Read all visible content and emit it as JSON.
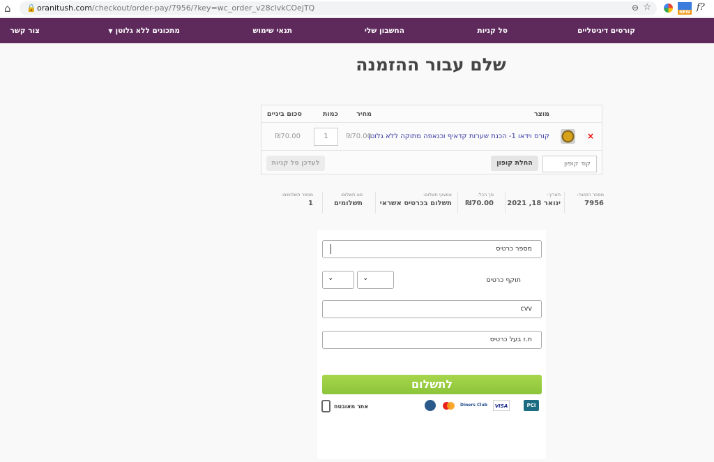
{
  "browser": {
    "url_host": "oranitush.com",
    "url_path": "/checkout/order-pay/7956/?key=wc_order_v28clvkCOejTQ",
    "ext_new_badge": "NEW",
    "ext_f_label": "f?"
  },
  "nav": {
    "items": [
      {
        "label": "קורסים דיגיטליים"
      },
      {
        "label": "סל קניות"
      },
      {
        "label": "החשבון שלי"
      },
      {
        "label": "תנאי שימוש"
      },
      {
        "label": "מתכונים ללא גלוטן"
      },
      {
        "label": "צור קשר"
      }
    ]
  },
  "page": {
    "title": "שלם עבור ההזמנה"
  },
  "order_table": {
    "headers": {
      "product": "מוצר",
      "price": "מחיר",
      "quantity": "כמות",
      "subtotal": "סכום ביניים"
    },
    "row": {
      "remove": "×",
      "name": "קורס וידאו 1- הכנת שערות קדאיף וכנאפה מתוקה ללא גלוטן",
      "price": "₪70.00",
      "quantity": "1",
      "subtotal": "₪70.00"
    },
    "coupon_placeholder": "קוד קופון",
    "apply_coupon": "החלת קופון",
    "update_cart": "לעדכן סל קניות"
  },
  "overview": [
    {
      "label": "מספר הזמנה:",
      "value": "7956"
    },
    {
      "label": "תאריך:",
      "value": "ינואר 18, 2021"
    },
    {
      "label": "סך הכל:",
      "value": "₪70.00"
    },
    {
      "label": "אמצעי תשלום:",
      "value": "תשלום בכרטיס אשראי"
    },
    {
      "label": "סוג תשלום:",
      "value": "תשלומים"
    },
    {
      "label": "מספר תשלומים:",
      "value": "1"
    }
  ],
  "payment": {
    "card_number_placeholder": "מספר כרטיס",
    "expiry_label": "תוקף כרטיס",
    "cvv_placeholder": "cvv",
    "id_placeholder": "ת.ז בעל כרטיס",
    "pay_button": "לתשלום",
    "secure_site": "אתר מאובטח",
    "brands": {
      "pci": "PCI",
      "visa": "VISA",
      "diners": "Diners Club"
    }
  },
  "colors": {
    "nav_bg": "#5e2a5c",
    "pay_button": "#8cc43a",
    "product_link": "#3a3aa8",
    "remove": "#e00000"
  }
}
